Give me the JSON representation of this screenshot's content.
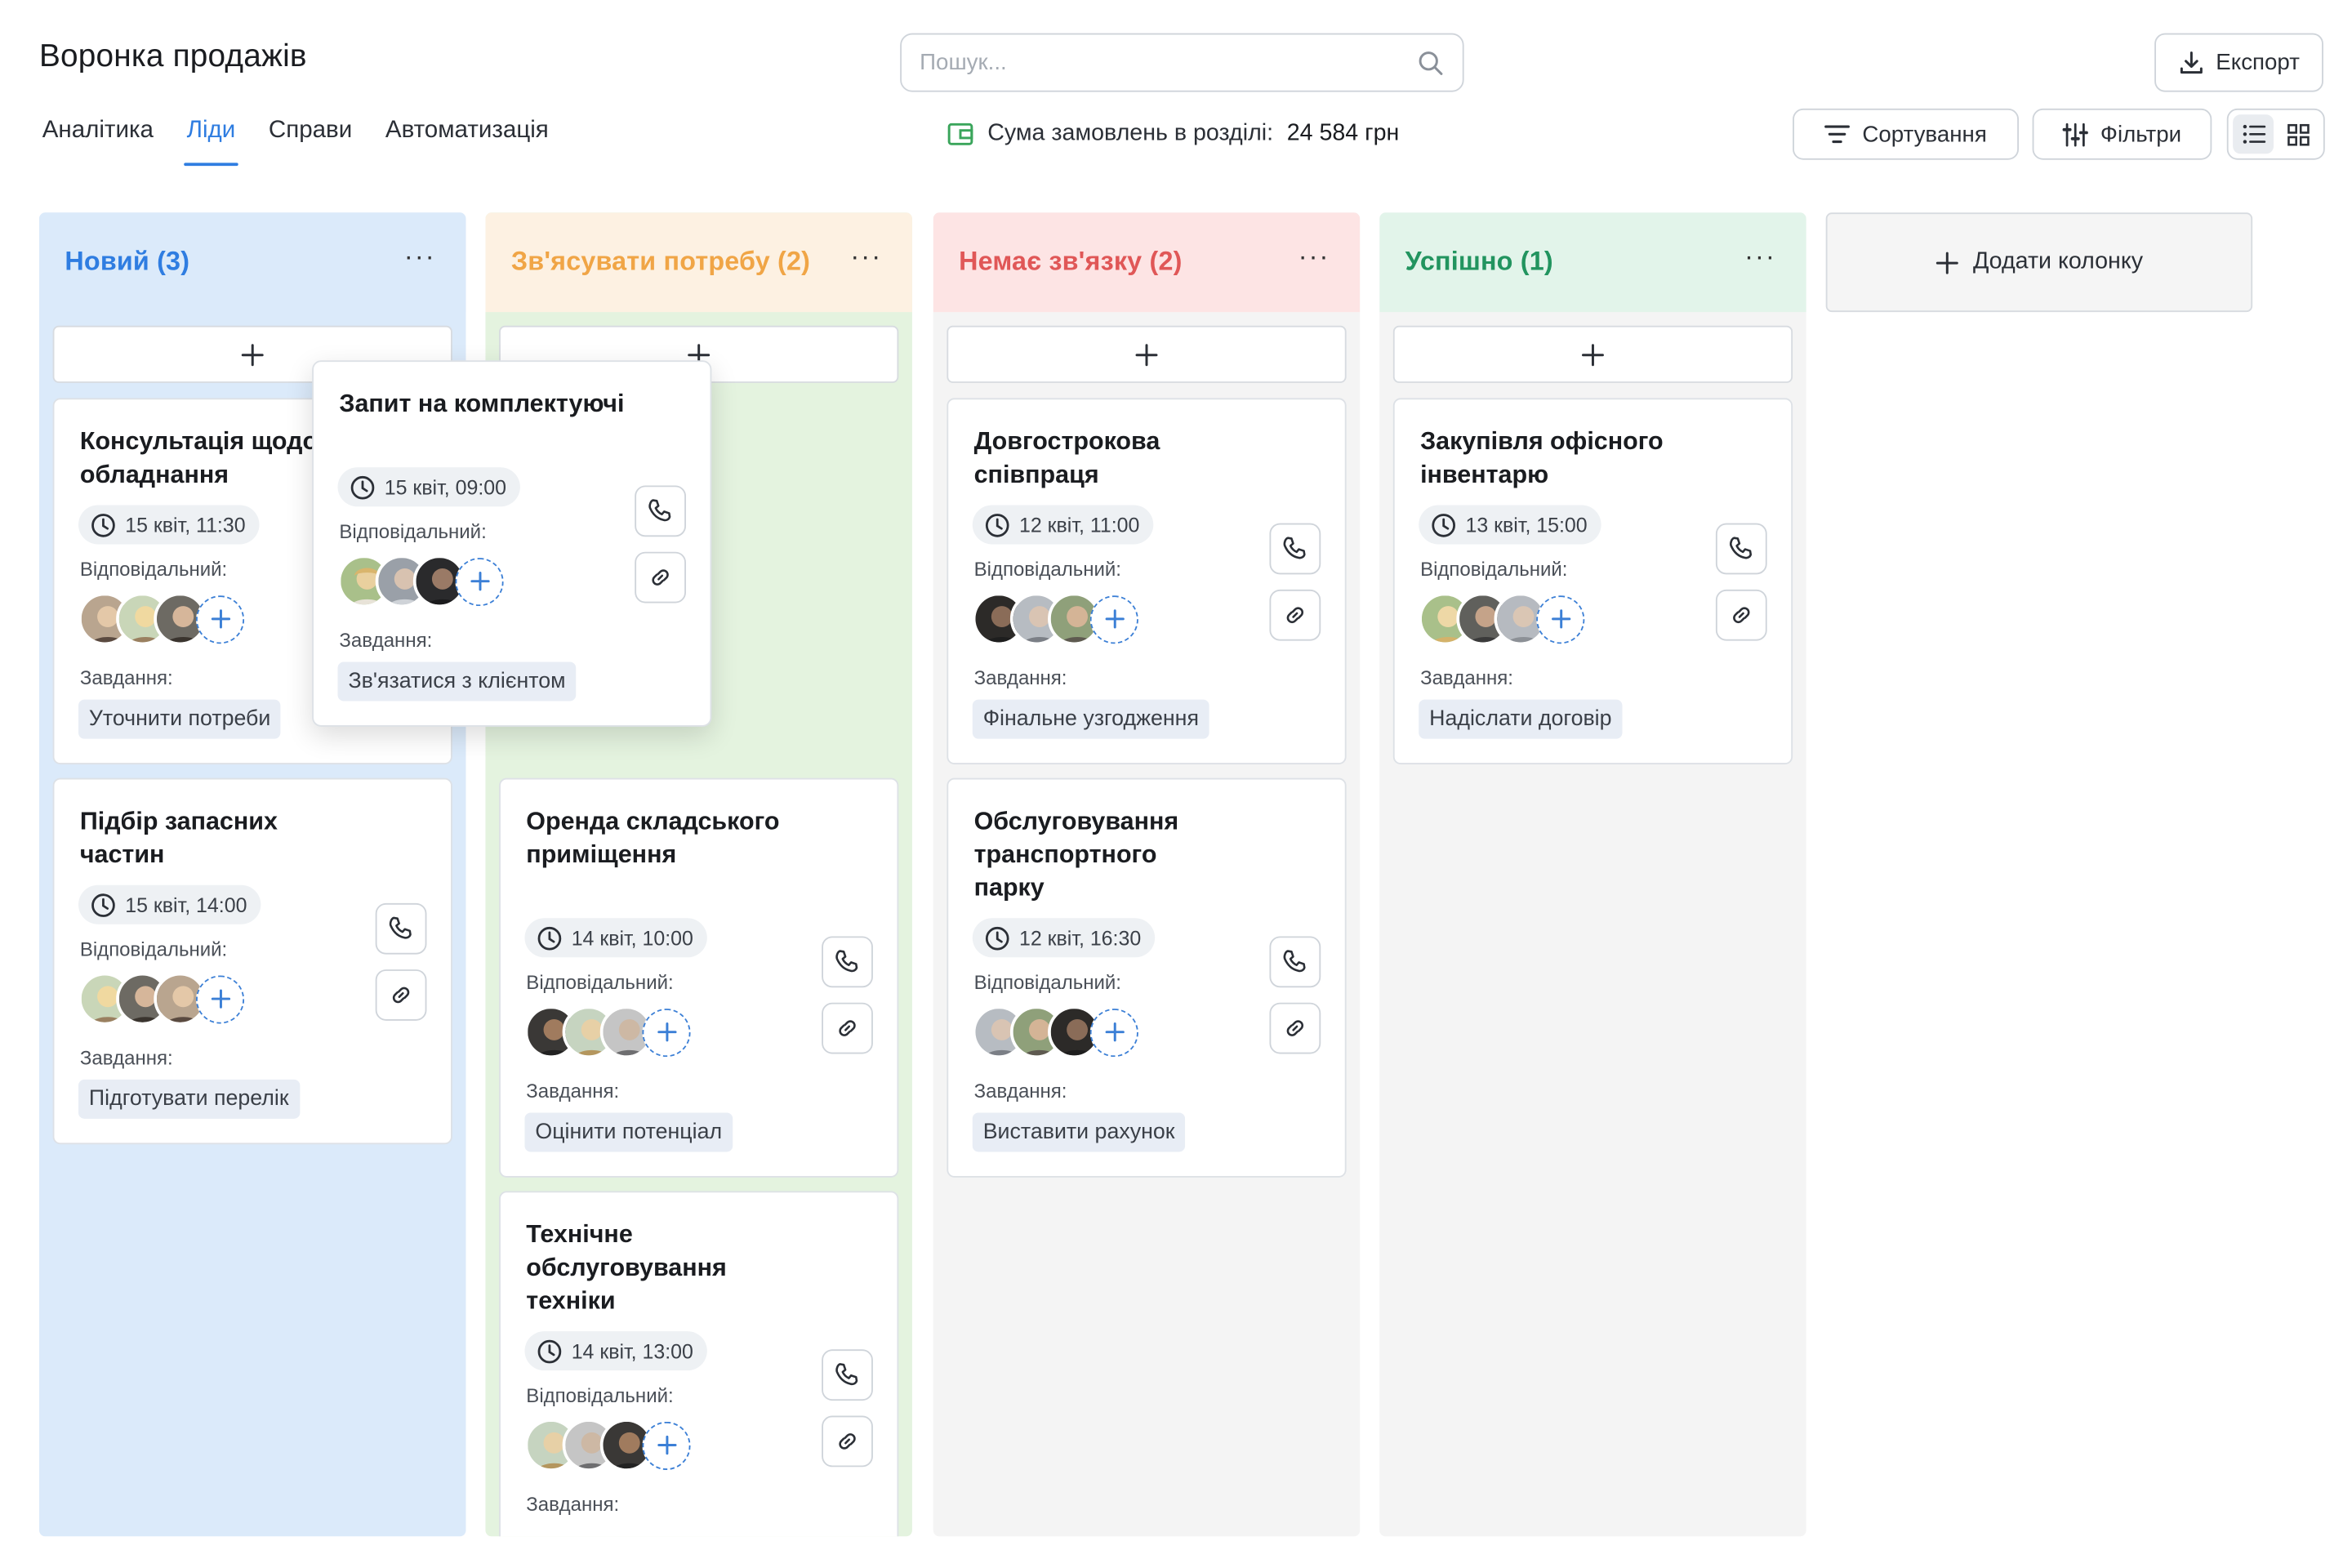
{
  "header": {
    "title": "Воронка продажів",
    "search_placeholder": "Пошук...",
    "export_label": "Експорт",
    "sort_label": "Сортування",
    "filter_label": "Фільтри"
  },
  "tabs": [
    {
      "label": "Аналітика",
      "active": false
    },
    {
      "label": "Ліди",
      "active": true
    },
    {
      "label": "Справи",
      "active": false
    },
    {
      "label": "Автоматизація",
      "active": false
    }
  ],
  "summary": {
    "label": "Сума замовлень в розділі:",
    "amount": "24 584 грн"
  },
  "labels": {
    "responsible": "Відповідальний:",
    "tasks": "Завдання:",
    "add_column": "Додати колонку",
    "more": "···"
  },
  "columns": [
    {
      "title": "Новий (3)",
      "color": "#2f7de1",
      "head_bg": "#dbeafa",
      "body_bg": "#dbeafa",
      "cards": [
        {
          "title": "Консультація щодо обладнання",
          "date": "15 квіт, 11:30",
          "task": "Уточнити потреби"
        },
        {
          "title": "Підбір запасних частин",
          "date": "15 квіт, 14:00",
          "task": "Підготувати перелік"
        }
      ]
    },
    {
      "title": "Зв'ясувати потребу (2)",
      "color": "#f0a546",
      "head_bg": "#fdf1e2",
      "body_bg": "#e4f3df",
      "cards": [
        {
          "title": "Оренда складського приміщення",
          "date": "14 квіт, 10:00",
          "task": "Оцінити потенціал"
        },
        {
          "title": "Технічне обслуговування техніки",
          "date": "14 квіт, 13:00",
          "task": ""
        }
      ]
    },
    {
      "title": "Немає зв'язку (2)",
      "color": "#e05757",
      "head_bg": "#fde4e4",
      "body_bg": "#f4f4f4",
      "cards": [
        {
          "title": "Довгострокова співпраця",
          "date": "12 квіт, 11:00",
          "task": "Фінальне узгодження"
        },
        {
          "title": "Обслуговування транспортного парку",
          "date": "12 квіт, 16:30",
          "task": "Виставити рахунок"
        }
      ]
    },
    {
      "title": "Успішно (1)",
      "color": "#22945f",
      "head_bg": "#e2f4ea",
      "body_bg": "#f4f4f4",
      "cards": [
        {
          "title": "Закупівля офісного інвентарю",
          "date": "13 квіт, 15:00",
          "task": "Надіслати договір"
        }
      ]
    }
  ],
  "popup_card": {
    "title": "Запит на комплектуючі",
    "date": "15 квіт, 09:00",
    "task": "Зв'язатися з клієнтом"
  },
  "icons": [
    "search-icon",
    "download-icon",
    "sort-icon",
    "filter-icon",
    "list-view-icon",
    "grid-view-icon",
    "wallet-icon",
    "clock-icon",
    "phone-icon",
    "link-icon",
    "plus-icon",
    "more-icon"
  ]
}
